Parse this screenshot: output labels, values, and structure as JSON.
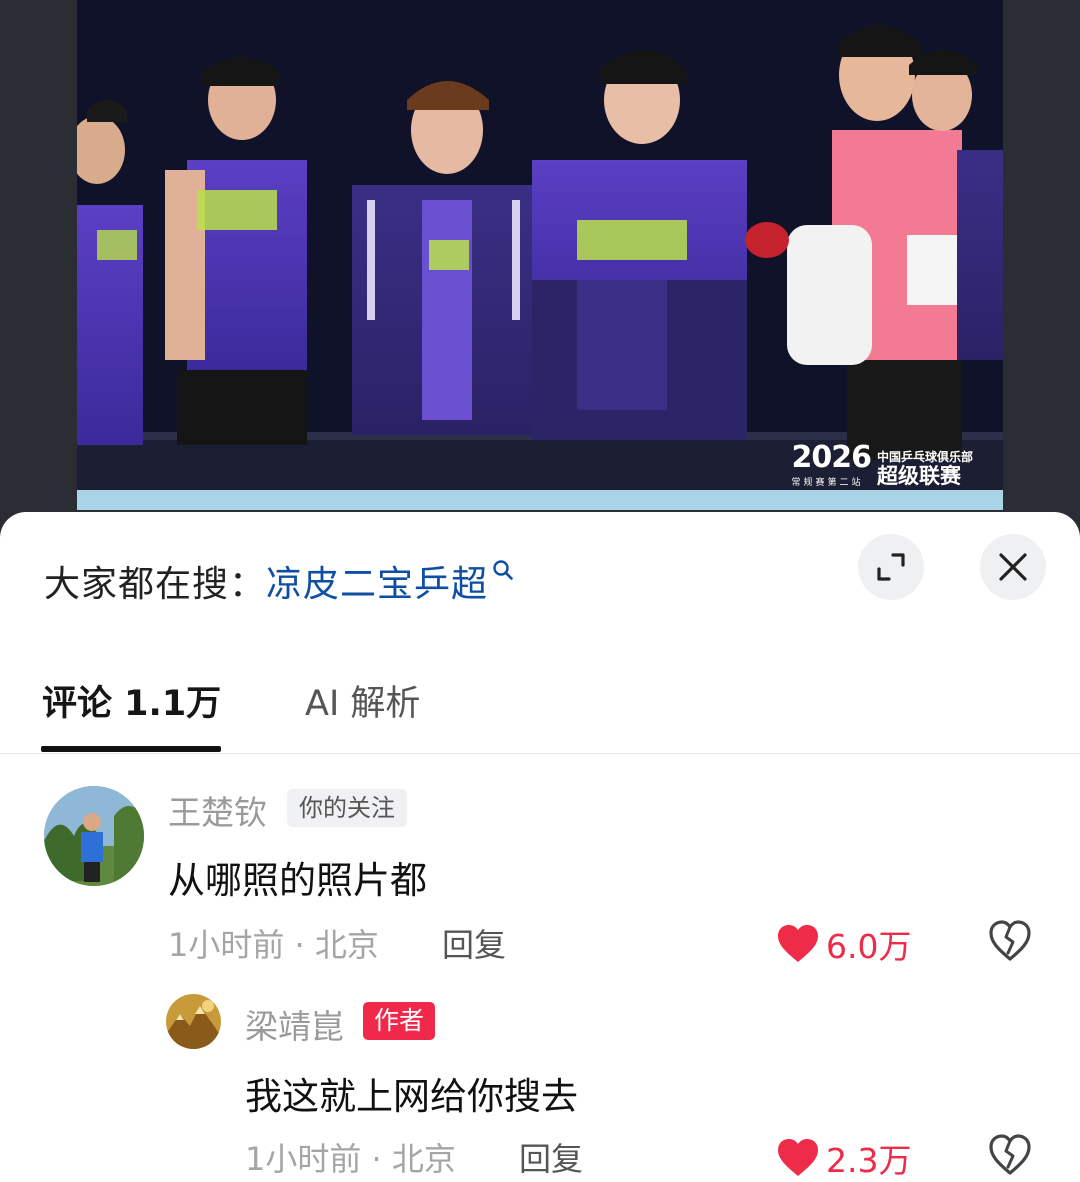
{
  "photo": {
    "watermark_year": "2026",
    "watermark_sub": "常规赛第二站",
    "watermark_org": "中国乒乓球俱乐部",
    "watermark_league": "超级联赛"
  },
  "search": {
    "prefix": "大家都在搜：",
    "term": "凉皮二宝乒超"
  },
  "tabs": {
    "comments": "评论 1.1万",
    "ai": "AI 解析"
  },
  "comments": [
    {
      "username": "王楚钦",
      "badge": "你的关注",
      "text": "从哪照的照片都",
      "meta": "1小时前 · 北京",
      "reply": "回复",
      "likes": "6.0万"
    },
    {
      "username": "梁靖崑",
      "badge": "作者",
      "text": "我这就上网给你搜去",
      "meta": "1小时前 · 北京",
      "reply": "回复",
      "likes": "2.3万"
    }
  ],
  "colors": {
    "accent_blue": "#0f4fa3",
    "like_red": "#ee2b48",
    "author_badge": "#f0284a"
  },
  "icons": [
    "search-icon",
    "expand-icon",
    "close-icon",
    "heart-icon",
    "broken-heart-icon"
  ]
}
